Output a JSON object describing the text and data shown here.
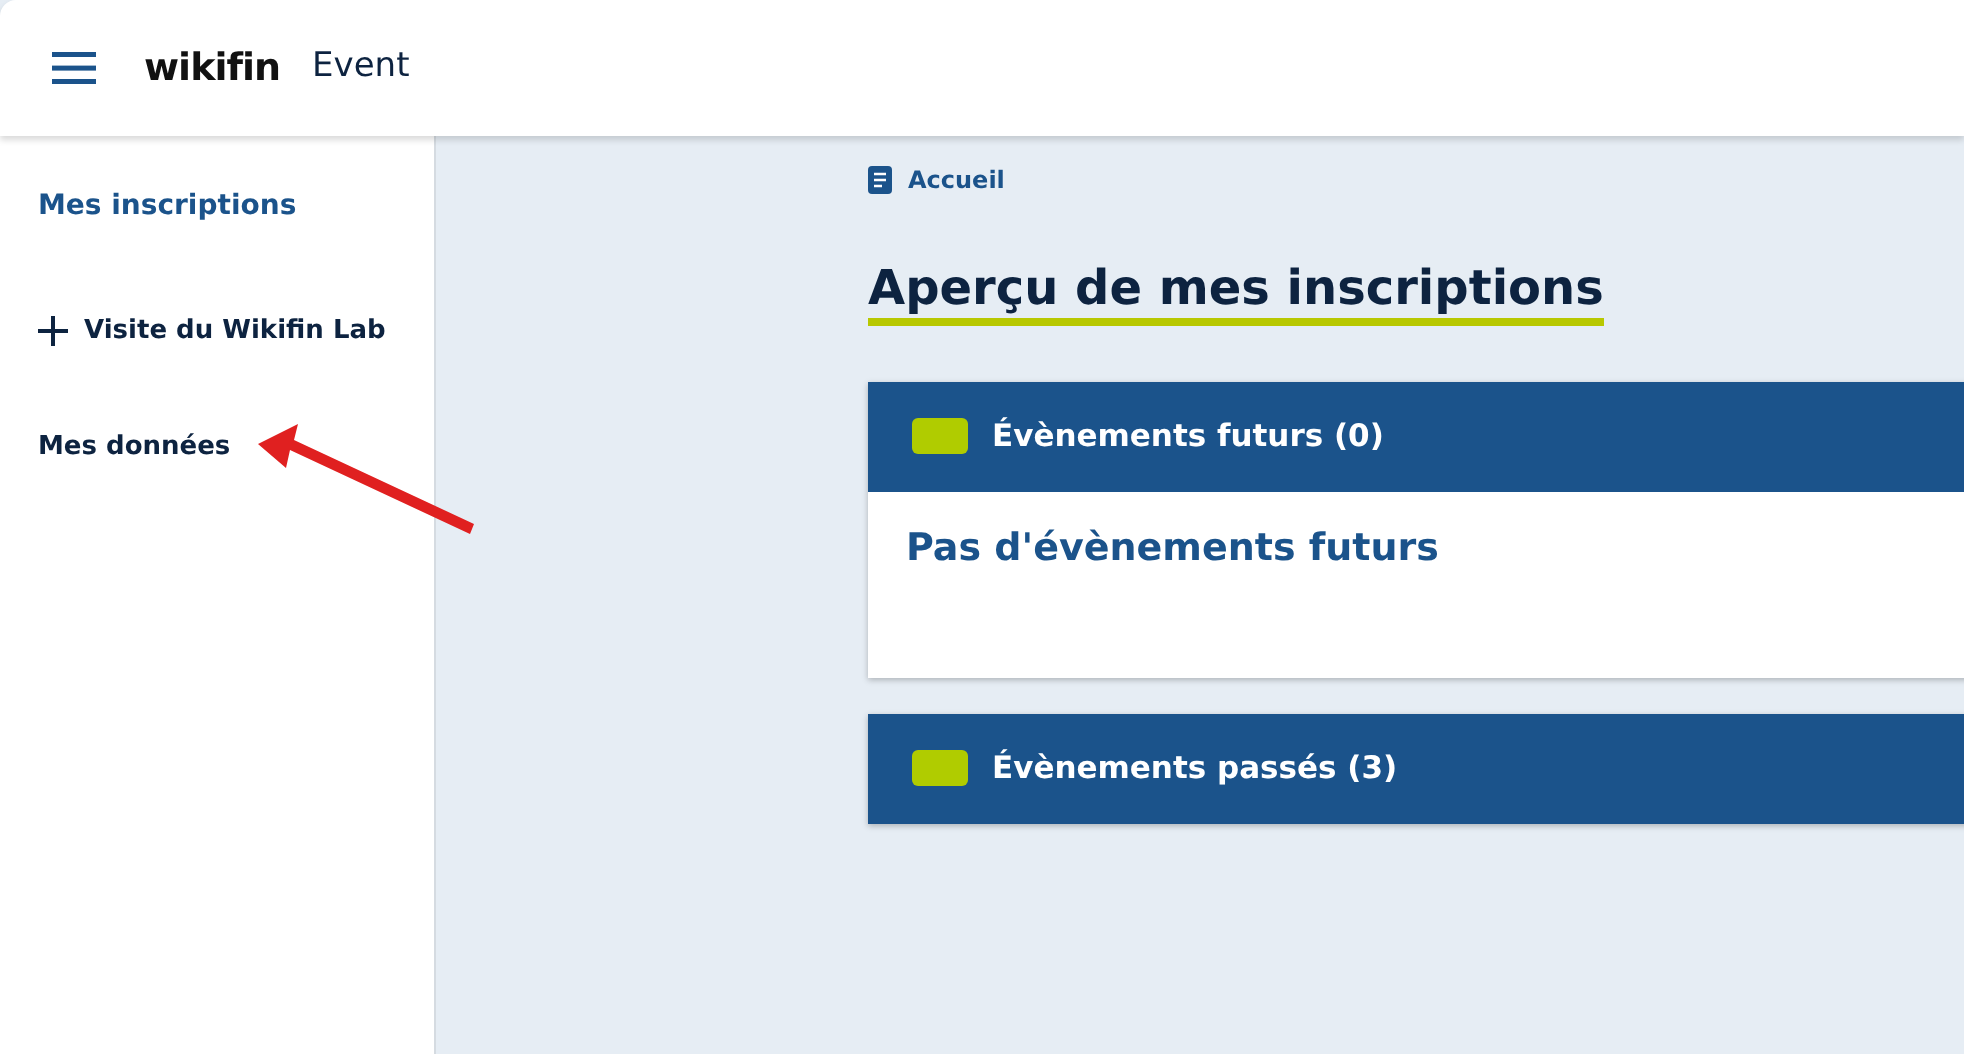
{
  "header": {
    "logo": "wikifin",
    "app_name": "Event"
  },
  "sidebar": {
    "items": [
      {
        "label": "Mes inscriptions",
        "kind": "link",
        "selected": true
      },
      {
        "label": "Visite du Wikifin Lab",
        "kind": "add",
        "selected": false
      },
      {
        "label": "Mes données",
        "kind": "link",
        "selected": false
      }
    ]
  },
  "breadcrumb": "Accueil",
  "title": "Aperçu de mes inscriptions",
  "sections": [
    {
      "title": "Évènements futurs (0)",
      "expanded": true,
      "body": "Pas d'évènements futurs"
    },
    {
      "title": "Évènements passés (3)",
      "expanded": false
    }
  ]
}
